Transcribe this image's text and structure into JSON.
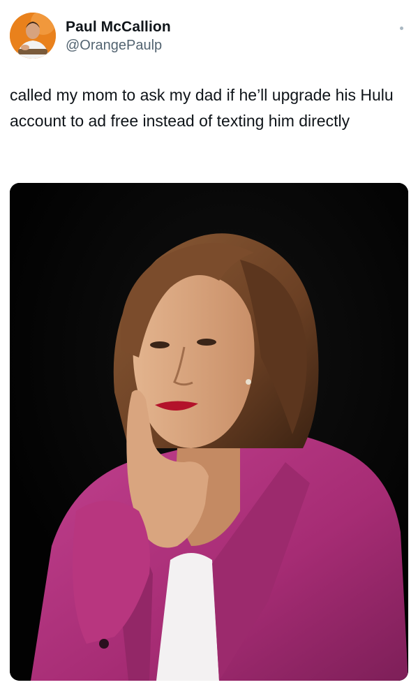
{
  "author": {
    "display_name": "Paul McCallion",
    "handle": "@OrangePaulp",
    "avatar_icon": "user-avatar-photo"
  },
  "tweet": {
    "text": "called my mom to ask my dad if he’ll upgrade his Hulu account to ad free instead of texting him directly"
  },
  "media": {
    "type": "photo",
    "icon": "photo-image"
  },
  "colors": {
    "text_primary": "#0f1419",
    "text_secondary": "#536471",
    "photo_background": "#030303",
    "jacket": "#b0327f",
    "avatar_background": "#e9811c"
  }
}
